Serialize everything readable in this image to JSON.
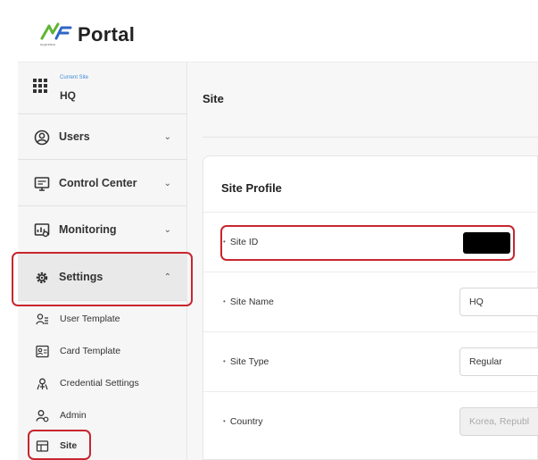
{
  "header": {
    "logo_text": "Portal",
    "logo_sub": "suprema",
    "logo_mark": "AF"
  },
  "sidebar": {
    "current_site_caption": "Current Site",
    "current_site_name": "HQ",
    "items": [
      {
        "label": "Users",
        "icon": "user-circle-icon",
        "chevron": "⌄"
      },
      {
        "label": "Control Center",
        "icon": "monitor-icon",
        "chevron": "⌄"
      },
      {
        "label": "Monitoring",
        "icon": "chart-monitor-icon",
        "chevron": "⌄"
      },
      {
        "label": "Settings",
        "icon": "gear-icon",
        "chevron": "⌃"
      }
    ],
    "subitems": [
      {
        "label": "User Template",
        "icon": "user-template-icon"
      },
      {
        "label": "Card Template",
        "icon": "card-template-icon"
      },
      {
        "label": "Credential Settings",
        "icon": "credential-icon"
      },
      {
        "label": "Admin",
        "icon": "admin-icon"
      },
      {
        "label": "Site",
        "icon": "site-icon"
      }
    ]
  },
  "main": {
    "page_title": "Site",
    "card_title": "Site Profile",
    "fields": [
      {
        "label": "Site ID",
        "value": ""
      },
      {
        "label": "Site Name",
        "value": "HQ"
      },
      {
        "label": "Site Type",
        "value": "Regular"
      },
      {
        "label": "Country",
        "value": "Korea, Republ"
      }
    ]
  },
  "colors": {
    "highlight": "#c8262f",
    "accent": "#3d8bd9",
    "logo_green": "#5fb531",
    "logo_blue": "#2f66c6"
  }
}
